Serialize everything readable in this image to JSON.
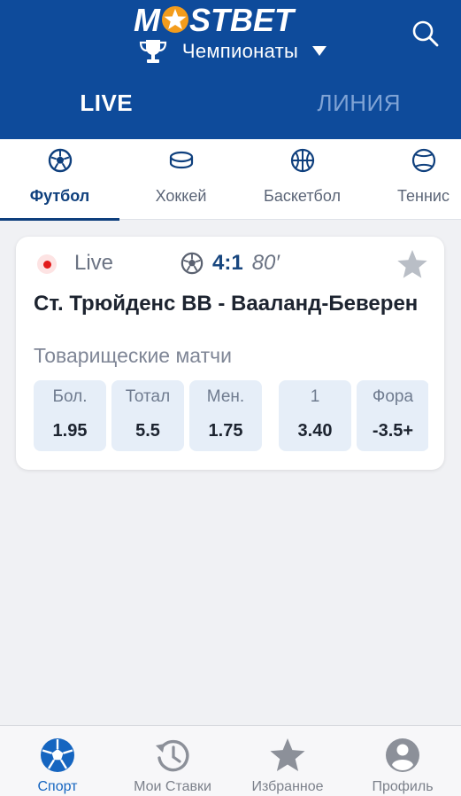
{
  "header": {
    "logo_text": "MOSTBET",
    "championships_label": "Чемпионаты",
    "tabs": [
      {
        "label": "LIVE",
        "active": true
      },
      {
        "label": "ЛИНИЯ",
        "active": false
      }
    ],
    "accent_color": "#0e4b9b"
  },
  "sport_tabs": [
    {
      "label": "Футбол",
      "icon": "soccer-ball-icon",
      "active": true
    },
    {
      "label": "Хоккей",
      "icon": "hockey-puck-icon",
      "active": false
    },
    {
      "label": "Баскетбол",
      "icon": "basketball-icon",
      "active": false
    },
    {
      "label": "Теннис",
      "icon": "tennis-ball-icon",
      "active": false
    }
  ],
  "match": {
    "live_label": "Live",
    "score": "4:1",
    "minute": "80′",
    "teams": "Ст. Трюйденс ВВ - Вааланд-Беверен",
    "league": "Товарищеские матчи",
    "odds": [
      {
        "label": "Бол.",
        "value": "1.95"
      },
      {
        "label": "Тотал",
        "value": "5.5"
      },
      {
        "label": "Мен.",
        "value": "1.75"
      },
      {
        "label": "1",
        "value": "3.40"
      },
      {
        "label": "Фора",
        "value": "-3.5+"
      }
    ]
  },
  "bottom_nav": [
    {
      "label": "Спорт",
      "icon": "soccer-ball-icon",
      "active": true
    },
    {
      "label": "Мои Ставки",
      "icon": "history-icon",
      "active": false
    },
    {
      "label": "Избранное",
      "icon": "star-icon",
      "active": false
    },
    {
      "label": "Профиль",
      "icon": "profile-icon",
      "active": false
    }
  ]
}
